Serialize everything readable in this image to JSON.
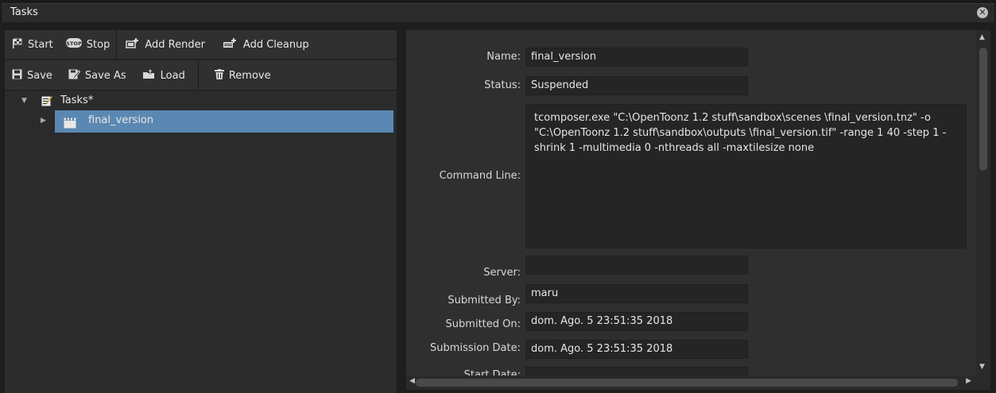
{
  "window": {
    "title": "Tasks",
    "close_glyph": "✕"
  },
  "toolbar1": [
    {
      "label": "Start",
      "icon": "flag-icon",
      "glyph": "⚑"
    },
    {
      "label": "Stop",
      "icon": "stop-icon",
      "glyph": "STOP"
    },
    {
      "label": "Add Render",
      "icon": "add-render-icon",
      "glyph": "▣"
    },
    {
      "label": "Add Cleanup",
      "icon": "add-cleanup-icon",
      "glyph": "▤"
    }
  ],
  "toolbar2": [
    {
      "label": "Save",
      "icon": "save-icon",
      "glyph": "▇"
    },
    {
      "label": "Save As",
      "icon": "save-as-icon",
      "glyph": "✎"
    },
    {
      "label": "Load",
      "icon": "load-icon",
      "glyph": "▲"
    },
    {
      "label": "Remove",
      "icon": "trash-icon",
      "glyph": "🗑"
    }
  ],
  "tree": {
    "root_label": "Tasks*",
    "items": [
      {
        "label": "final_version"
      }
    ]
  },
  "details": {
    "name_label": "Name:",
    "name_value": "final_version",
    "status_label": "Status:",
    "status_value": "Suspended",
    "cmd_label": "Command Line:",
    "cmd_value": "tcomposer.exe  \"C:\\OpenToonz 1.2 stuff\\sandbox\\scenes \\final_version.tnz\" -o \"C:\\OpenToonz 1.2 stuff\\sandbox\\outputs \\final_version.tif\" -range 1 40 -step 1 -shrink 1 -multimedia 0 -nthreads all -maxtilesize none",
    "server_label": "Server:",
    "server_value": "",
    "submitted_by_label": "Submitted By:",
    "submitted_by_value": "maru",
    "submitted_on_label": "Submitted On:",
    "submitted_on_value": "dom. Ago. 5 23:51:35 2018",
    "submission_date_label": "Submission Date:",
    "submission_date_value": "dom. Ago. 5 23:51:35 2018",
    "start_date_label": "Start Date:"
  },
  "colors": {
    "selection": "#5a88b2",
    "panel": "#2f2f2f",
    "field": "#252525"
  }
}
